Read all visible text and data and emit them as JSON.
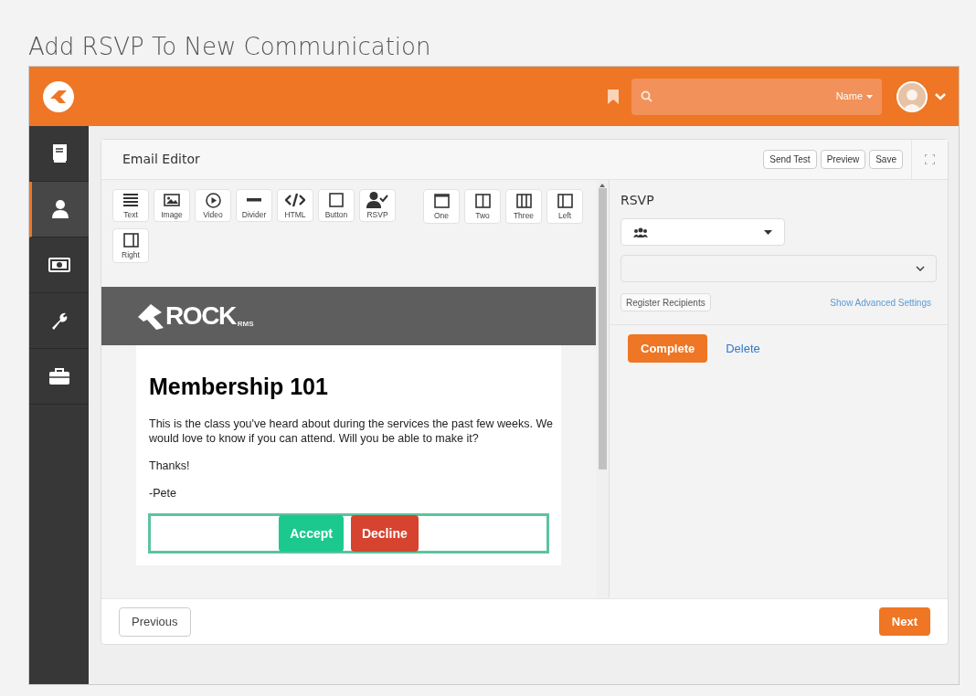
{
  "page_title": "Add RSVP To New Communication",
  "header": {
    "search": {
      "scope": "Name"
    }
  },
  "sidebar": {
    "items": [
      {
        "selected": false
      },
      {
        "selected": true
      },
      {
        "selected": false
      },
      {
        "selected": false
      },
      {
        "selected": false
      }
    ]
  },
  "panel": {
    "title": "Email Editor",
    "actions": [
      "Send Test",
      "Preview",
      "Save"
    ]
  },
  "toolbar": {
    "components": [
      "Text",
      "Image",
      "Video",
      "Divider",
      "HTML",
      "Button",
      "RSVP"
    ],
    "layouts": [
      "One",
      "Two",
      "Three",
      "Left",
      "Right"
    ]
  },
  "email": {
    "logo": "ROCK",
    "logo_sub": "RMS",
    "heading": "Membership 101",
    "paragraphs": [
      "This is the class you've heard about during the services the past few weeks. We would love to know if you can attend. Will you be able to make it?",
      "Thanks!",
      "-Pete"
    ],
    "buttons": [
      {
        "label": "Accept",
        "color": "#1bc98e"
      },
      {
        "label": "Decline",
        "color": "#d6432f"
      }
    ]
  },
  "rsvp": {
    "title": "RSVP",
    "register_button": "Register Recipients",
    "advanced_link": "Show Advanced Settings",
    "complete_button": "Complete",
    "delete_link": "Delete"
  },
  "footer": {
    "previous": "Previous",
    "next": "Next"
  }
}
